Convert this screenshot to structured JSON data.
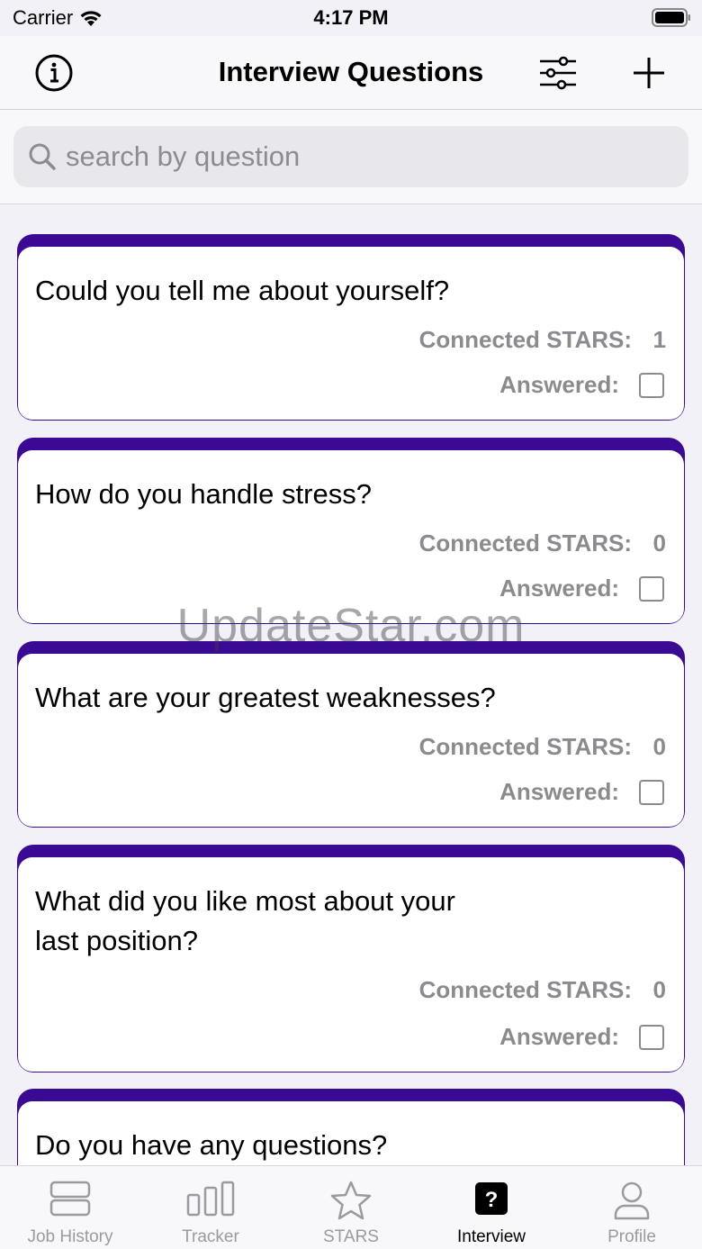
{
  "status_bar": {
    "carrier": "Carrier",
    "time": "4:17 PM"
  },
  "header": {
    "title": "Interview Questions"
  },
  "search": {
    "placeholder": "search by question"
  },
  "accent_color": "#3b0a94",
  "labels": {
    "connected_stars": "Connected STARS:",
    "answered": "Answered:"
  },
  "questions": [
    {
      "text": "Could you tell me about yourself?",
      "connected_stars": "1",
      "answered": false
    },
    {
      "text": "How do you handle stress?",
      "connected_stars": "0",
      "answered": false
    },
    {
      "text": "What are your greatest weaknesses?",
      "connected_stars": "0",
      "answered": false
    },
    {
      "text": "What did you like most about your last position?",
      "connected_stars": "0",
      "answered": false
    },
    {
      "text": "Do you have any questions?"
    }
  ],
  "watermark": "UpdateStar.com",
  "tabs": [
    {
      "label": "Job History",
      "icon": "job-history-icon",
      "active": false
    },
    {
      "label": "Tracker",
      "icon": "tracker-icon",
      "active": false
    },
    {
      "label": "STARS",
      "icon": "star-icon",
      "active": false
    },
    {
      "label": "Interview",
      "icon": "interview-icon",
      "active": true
    },
    {
      "label": "Profile",
      "icon": "profile-icon",
      "active": false
    }
  ]
}
